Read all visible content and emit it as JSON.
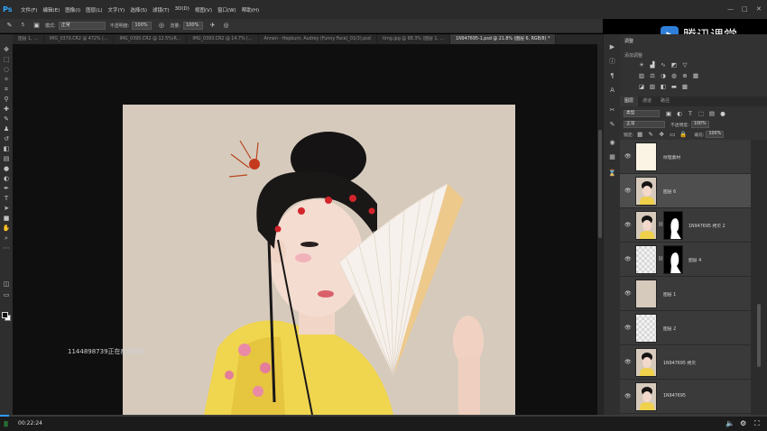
{
  "app": {
    "logo": "Ps"
  },
  "menu": [
    "文件(F)",
    "编辑(E)",
    "图像(I)",
    "图层(L)",
    "文字(Y)",
    "选择(S)",
    "滤镜(T)",
    "3D(D)",
    "视图(V)",
    "窗口(W)",
    "帮助(H)"
  ],
  "options": {
    "mode_label": "模式:",
    "mode_value": "正常",
    "opacity_label": "不透明度:",
    "opacity_value": "100%",
    "flow_label": "流量:",
    "flow_value": "100%",
    "size_value": "5"
  },
  "tabs": [
    "图层 1, ...",
    "IMG_0370.CR2 @ 472% (...",
    "IMG_0395.CR2 @ 12.5%(R...",
    "IMG_0393.CR2 @ 14.7% (...",
    "Annen - Hepburn, Audrey (Funny Face)_01(3).psd",
    "timg.jpg @ 88.3% (图层 1, ...",
    "1N947695-1.psd @ 21.8% (图层 6, RGB/8) *"
  ],
  "active_tab_index": 6,
  "canvas": {
    "watermark": "1144898739正在痴痴直播"
  },
  "brand": {
    "name": "腾讯课堂"
  },
  "adjustments": {
    "title": "调整",
    "subtitle": "添加调整"
  },
  "layers_panel": {
    "tabs": [
      "图层",
      "通道",
      "路径"
    ],
    "kind_label": "类型",
    "blend_mode": "正常",
    "opacity_label": "不透明度:",
    "opacity_value": "100%",
    "lock_label": "锁定:",
    "fill_label": "填充:",
    "fill_value": "100%",
    "layers": [
      {
        "name": "纹理素材",
        "thumb": "cream",
        "mask": false
      },
      {
        "name": "图层 6",
        "thumb": "photo",
        "mask": false,
        "selected": true
      },
      {
        "name": "1N947695 拷贝 2",
        "thumb": "photo",
        "mask": true
      },
      {
        "name": "图层 4",
        "thumb": "checker",
        "mask": true
      },
      {
        "name": "图层 1",
        "thumb": "beige",
        "mask": false
      },
      {
        "name": "图层 2",
        "thumb": "checker",
        "mask": false
      },
      {
        "name": "1N947695 拷贝",
        "thumb": "photo",
        "mask": false
      },
      {
        "name": "1N947695",
        "thumb": "photo",
        "mask": false
      }
    ]
  },
  "video": {
    "timecode": "00:22:24",
    "progress": 0.012
  }
}
